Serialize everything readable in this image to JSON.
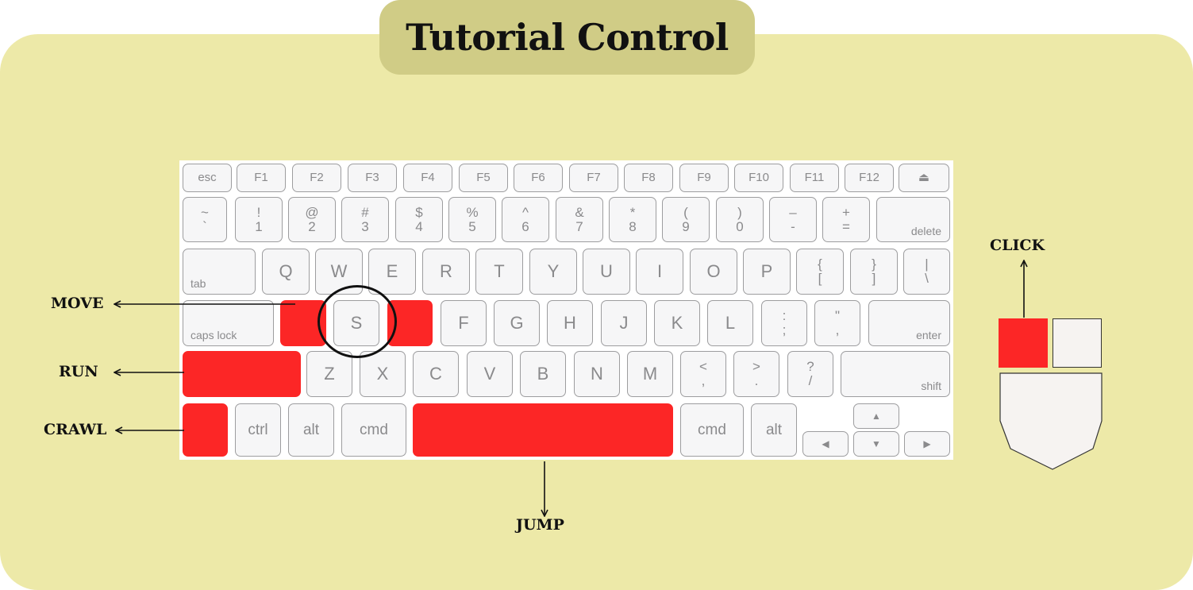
{
  "title": "Tutorial Control",
  "labels": {
    "move": "MOVE",
    "run": "RUN",
    "crawl": "CRAWL",
    "jump": "JUMP",
    "click": "CLICK"
  },
  "keys": {
    "esc": "esc",
    "f1": "F1",
    "f2": "F2",
    "f3": "F3",
    "f4": "F4",
    "f5": "F5",
    "f6": "F6",
    "f7": "F7",
    "f8": "F8",
    "f9": "F9",
    "f10": "F10",
    "f11": "F11",
    "f12": "F12",
    "eject": "⏏",
    "tilde_top": "~",
    "tilde_bot": "`",
    "n1_top": "!",
    "n1_bot": "1",
    "n2_top": "@",
    "n2_bot": "2",
    "n3_top": "#",
    "n3_bot": "3",
    "n4_top": "$",
    "n4_bot": "4",
    "n5_top": "%",
    "n5_bot": "5",
    "n6_top": "^",
    "n6_bot": "6",
    "n7_top": "&",
    "n7_bot": "7",
    "n8_top": "*",
    "n8_bot": "8",
    "n9_top": "(",
    "n9_bot": "9",
    "n0_top": ")",
    "n0_bot": "0",
    "minus_top": "–",
    "minus_bot": "-",
    "plus_top": "+",
    "plus_bot": "=",
    "delete": "delete",
    "tab": "tab",
    "q": "Q",
    "w": "W",
    "e": "E",
    "r": "R",
    "t": "T",
    "y": "Y",
    "u": "U",
    "i": "I",
    "o": "O",
    "p": "P",
    "lbrace_top": "{",
    "lbrace_bot": "[",
    "rbrace_top": "}",
    "rbrace_bot": "]",
    "pipe_top": "|",
    "pipe_bot": "\\",
    "caps": "caps lock",
    "s": "S",
    "f": "F",
    "g": "G",
    "h": "H",
    "j": "J",
    "k": "K",
    "l": "L",
    "colon_top": ":",
    "colon_bot": ";",
    "quote_top": "\"",
    "quote_bot": ",",
    "enter": "enter",
    "z": "Z",
    "x": "X",
    "c": "C",
    "v": "V",
    "b": "B",
    "n": "N",
    "m": "M",
    "lt_top": "<",
    "lt_bot": ",",
    "gt_top": ">",
    "gt_bot": ".",
    "q_top": "?",
    "q_bot": "/",
    "shift": "shift",
    "ctrl": "ctrl",
    "alt_l": "alt",
    "cmd_l": "cmd",
    "cmd_r": "cmd",
    "alt_r": "alt",
    "up": "▲",
    "left": "◀",
    "down": "▼",
    "right": "▶"
  },
  "colors": {
    "highlight": "#fc2626",
    "panel": "#ede9a8",
    "title_bg": "#d0cc86"
  }
}
